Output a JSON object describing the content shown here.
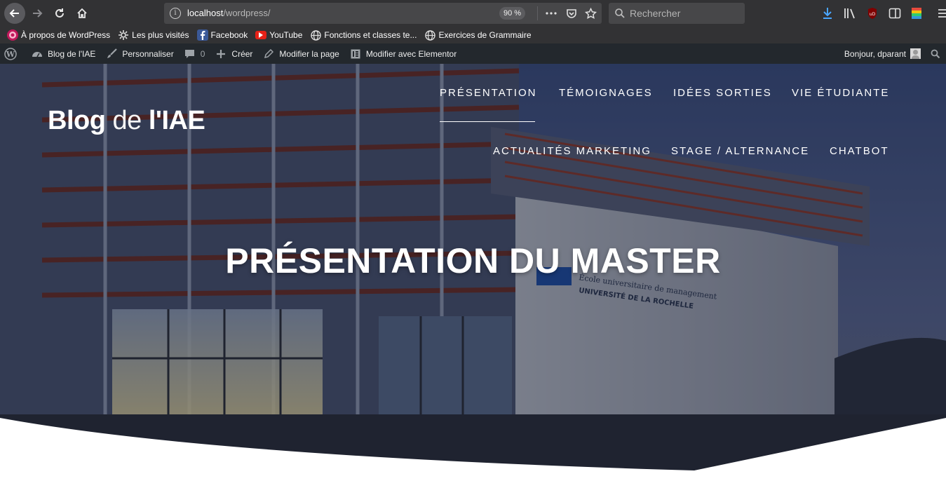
{
  "browser": {
    "url_host": "localhost",
    "url_path": "/wordpress/",
    "zoom": "90 %",
    "search_placeholder": "Rechercher"
  },
  "bookmarks": [
    {
      "label": "À propos de WordPress",
      "icon": "wordpress-bookmark-icon"
    },
    {
      "label": "Les plus visités",
      "icon": "gear-icon"
    },
    {
      "label": "Facebook",
      "icon": "facebook-icon"
    },
    {
      "label": "YouTube",
      "icon": "youtube-icon"
    },
    {
      "label": "Fonctions et classes te...",
      "icon": "globe-icon"
    },
    {
      "label": "Exercices de Grammaire",
      "icon": "globe-icon"
    }
  ],
  "adminbar": {
    "site_name": "Blog de l'IAE",
    "customize": "Personnaliser",
    "comments_count": "0",
    "new": "Créer",
    "edit_page": "Modifier la page",
    "edit_elementor": "Modifier avec Elementor",
    "greeting": "Bonjour, dparant"
  },
  "site": {
    "title_bold_1": "Blog",
    "title_light": "de",
    "title_bold_2": "l'IAE"
  },
  "menu": {
    "row1": [
      "PRÉSENTATION",
      "TÉMOIGNAGES",
      "IDÉES SORTIES",
      "VIE ÉTUDIANTE"
    ],
    "row2": [
      "ACTUALITÉS MARKETING",
      "STAGE / ALTERNANCE",
      "CHATBOT"
    ],
    "active": "PRÉSENTATION"
  },
  "hero": {
    "title": "PRÉSENTATION DU MASTER",
    "building_sign_line1": "École universitaire de management",
    "building_sign_line2": "UNIVERSITÉ DE LA ROCHELLE"
  },
  "colors": {
    "toolbar": "#323234",
    "adminbar": "#23282d",
    "accent_download": "#4aa6ff"
  }
}
